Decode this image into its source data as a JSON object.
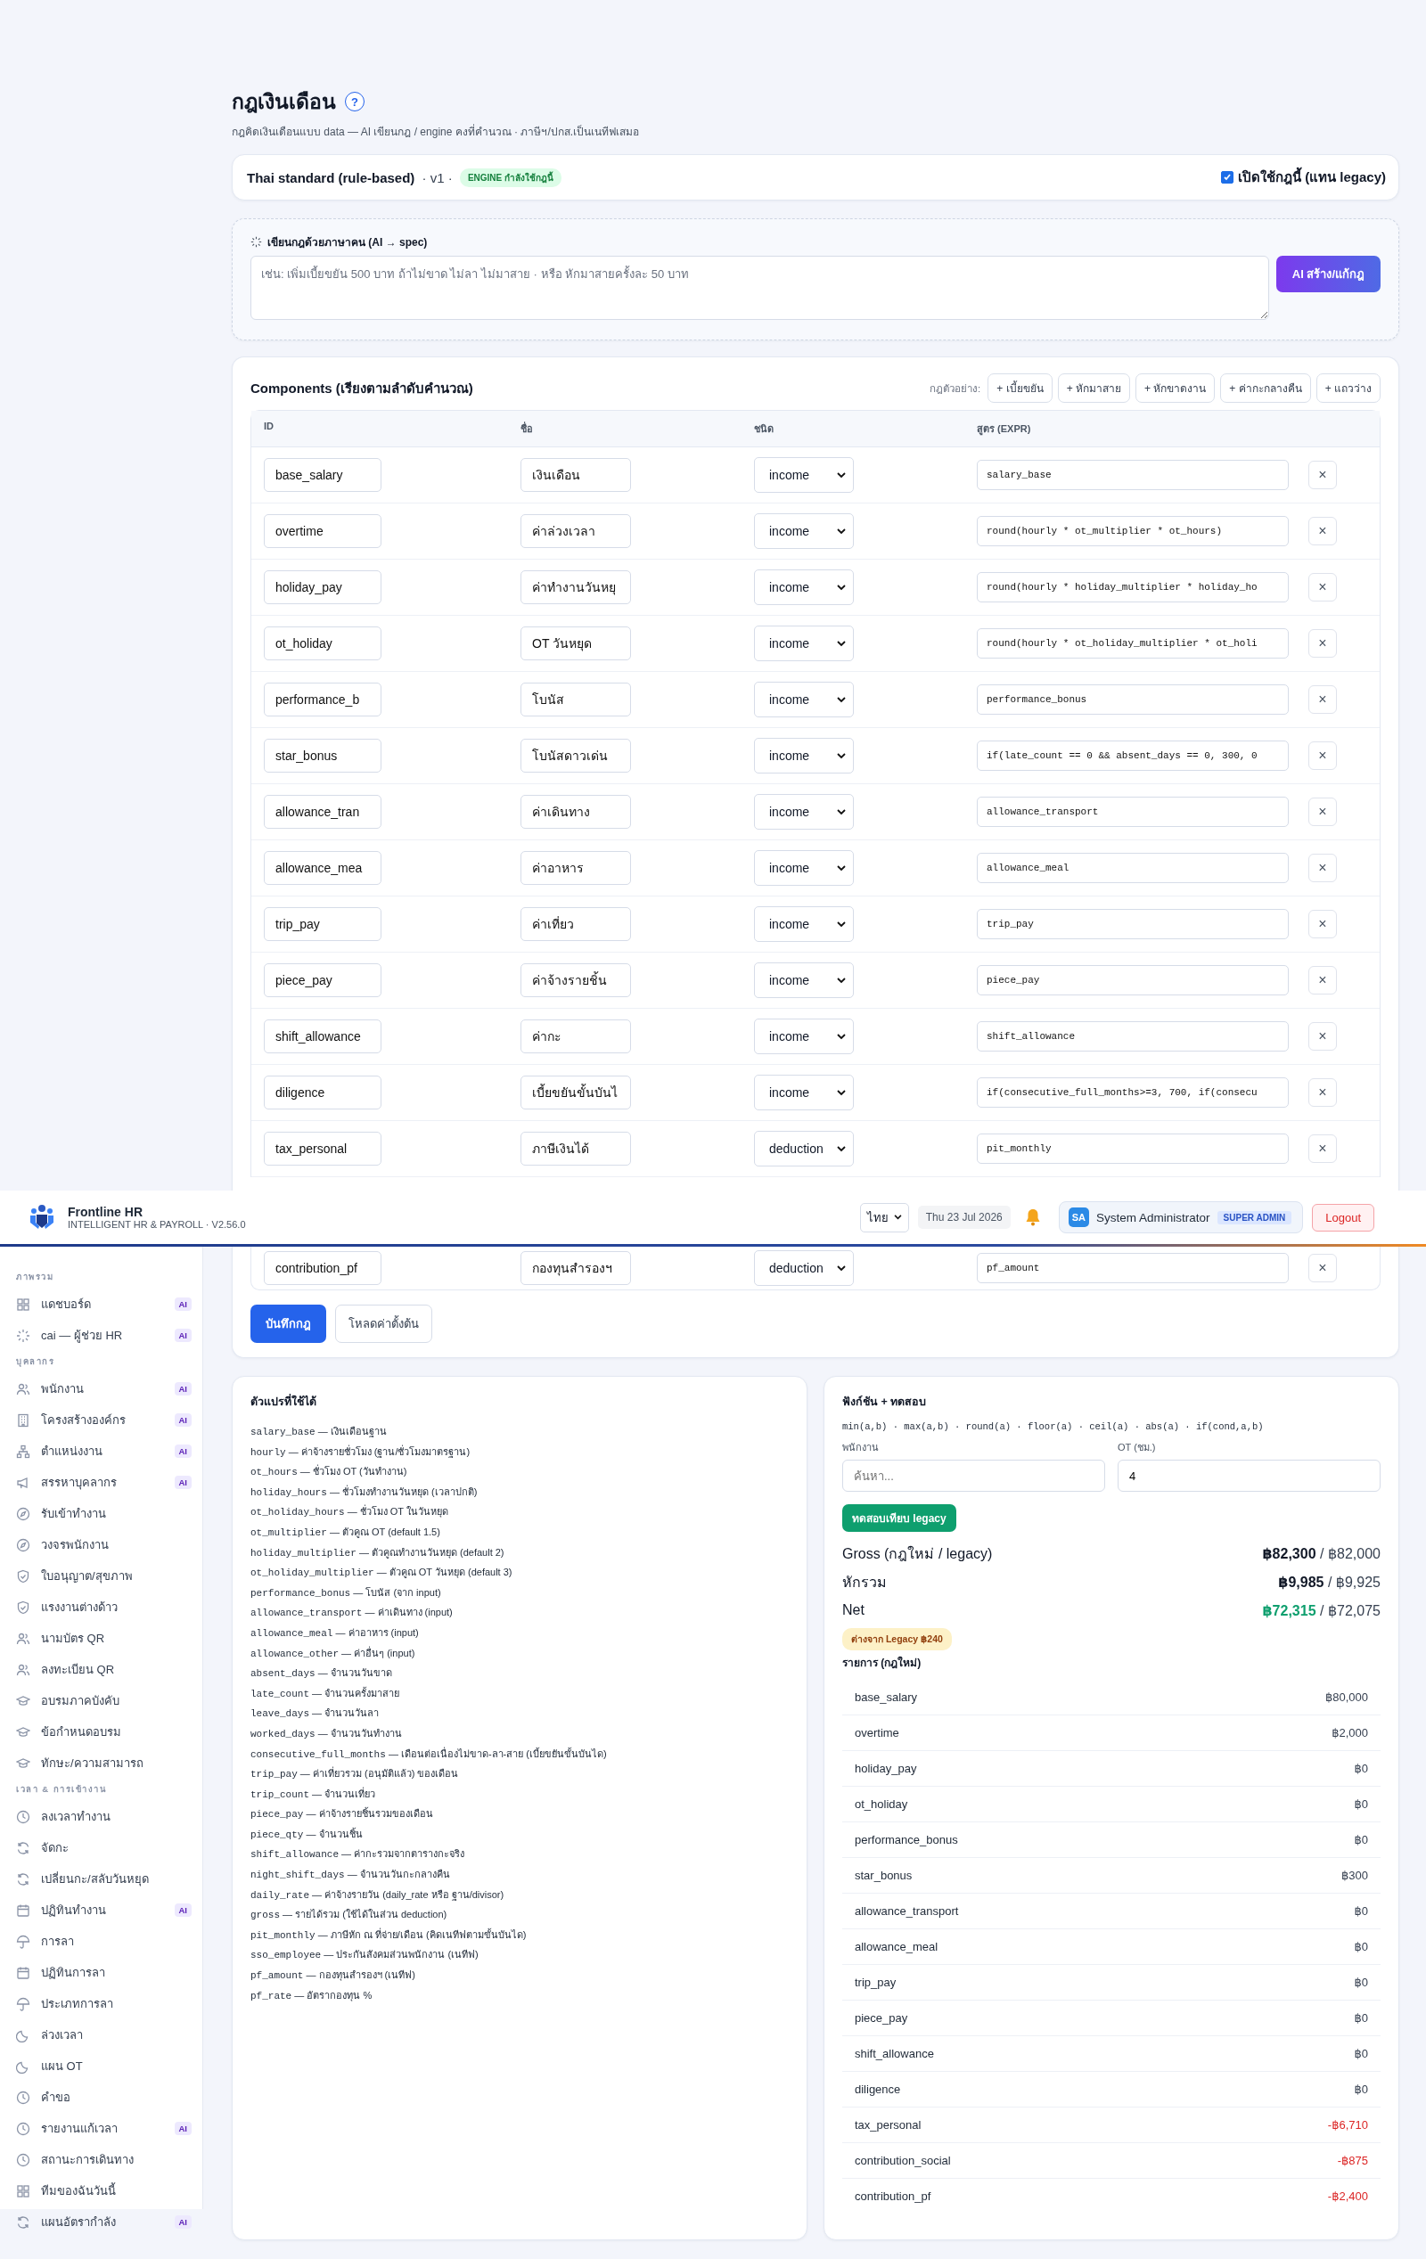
{
  "page": {
    "title": "กฎเงินเดือน",
    "help": "?",
    "subtitle": "กฎคิดเงินเดือนแบบ data — AI เขียนกฎ / engine คงที่คำนวณ · ภาษีฯ/ปกส.เป็นเนทีฟเสมอ"
  },
  "rule": {
    "name": "Thai standard (rule-based)",
    "version": " · v1 · ",
    "badge": "ENGINE กำลังใช้กฎนี้",
    "enabled": true,
    "enabled_label": "เปิดใช้กฎนี้ (แทน legacy)"
  },
  "ai_spec": {
    "title": "เขียนกฎด้วยภาษาคน (AI → spec)",
    "placeholder": "เช่น: เพิ่มเบี้ยขยัน 500 บาท ถ้าไม่ขาด ไม่ลา ไม่มาสาย · หรือ หักมาสายครั้งละ 50 บาท",
    "button": "AI สร้าง/แก้กฎ"
  },
  "components": {
    "title": "Components (เรียงตามลำดับคำนวณ)",
    "examples_label": "กฎตัวอย่าง:",
    "examples": [
      "+ เบี้ยขยัน",
      "+ หักมาสาย",
      "+ หักขาดงาน",
      "+ ค่ากะกลางคืน",
      "+ แถวว่าง"
    ],
    "columns": [
      "ID",
      "ชื่อ",
      "ชนิด",
      "สูตร (EXPR)"
    ],
    "rows": [
      {
        "id": "base_salary",
        "name": "เงินเดือน",
        "type": "income",
        "expr": "salary_base",
        "remove": "×"
      },
      {
        "id": "overtime",
        "name": "ค่าล่วงเวลา",
        "type": "income",
        "expr": "round(hourly * ot_multiplier * ot_hours)",
        "remove": "×"
      },
      {
        "id": "holiday_pay",
        "name": "ค่าทำงานวันหยุ",
        "type": "income",
        "expr": "round(hourly * holiday_multiplier * holiday_ho",
        "remove": "×"
      },
      {
        "id": "ot_holiday",
        "name": "OT วันหยุด",
        "type": "income",
        "expr": "round(hourly * ot_holiday_multiplier * ot_holi",
        "remove": "×"
      },
      {
        "id": "performance_b",
        "name": "โบนัส",
        "type": "income",
        "expr": "performance_bonus",
        "remove": "×"
      },
      {
        "id": "star_bonus",
        "name": "โบนัสดาวเด่น",
        "type": "income",
        "expr": "if(late_count == 0 && absent_days == 0, 300, 0",
        "remove": "×"
      },
      {
        "id": "allowance_tran",
        "name": "ค่าเดินทาง",
        "type": "income",
        "expr": "allowance_transport",
        "remove": "×"
      },
      {
        "id": "allowance_mea",
        "name": "ค่าอาหาร",
        "type": "income",
        "expr": "allowance_meal",
        "remove": "×"
      },
      {
        "id": "trip_pay",
        "name": "ค่าเที่ยว",
        "type": "income",
        "expr": "trip_pay",
        "remove": "×"
      },
      {
        "id": "piece_pay",
        "name": "ค่าจ้างรายชิ้น",
        "type": "income",
        "expr": "piece_pay",
        "remove": "×"
      },
      {
        "id": "shift_allowance",
        "name": "ค่ากะ",
        "type": "income",
        "expr": "shift_allowance",
        "remove": "×"
      },
      {
        "id": "diligence",
        "name": "เบี้ยขยันขั้นบันไ",
        "type": "income",
        "expr": "if(consecutive_full_months>=3, 700, if(consecu",
        "remove": "×"
      },
      {
        "id": "tax_personal",
        "name": "ภาษีเงินได้",
        "type": "deduction",
        "expr": "pit_monthly",
        "remove": "×"
      },
      {
        "id": "contribution_pf",
        "name": "กองทุนสำรองฯ",
        "type": "deduction",
        "expr": "pf_amount",
        "remove": "×"
      }
    ],
    "save": "บันทึกกฎ",
    "reset": "โหลดค่าตั้งต้น"
  },
  "header": {
    "brand": "Frontline HR",
    "tagline": "INTELLIGENT HR & PAYROLL · V2.56.0",
    "language": "ไทย",
    "date": "Thu 23 Jul 2026",
    "avatar": "SA",
    "user": "System Administrator",
    "role": "SUPER ADMIN",
    "logout": "Logout"
  },
  "sidebar": [
    {
      "title": "ภาพรวม",
      "items": [
        {
          "label": "แดชบอร์ด",
          "badge": "AI"
        },
        {
          "label": "cai — ผู้ช่วย HR",
          "badge": "AI"
        }
      ]
    },
    {
      "title": "บุคลากร",
      "items": [
        {
          "label": "พนักงาน",
          "badge": "AI"
        },
        {
          "label": "โครงสร้างองค์กร",
          "badge": "AI"
        },
        {
          "label": "ตำแหน่งงาน",
          "badge": "AI"
        },
        {
          "label": "สรรหาบุคลากร",
          "badge": "AI"
        },
        {
          "label": "รับเข้าทำงาน"
        },
        {
          "label": "วงจรพนักงาน"
        },
        {
          "label": "ใบอนุญาต/สุขภาพ"
        },
        {
          "label": "แรงงานต่างด้าว"
        },
        {
          "label": "นามบัตร QR"
        },
        {
          "label": "ลงทะเบียน QR"
        },
        {
          "label": "อบรมภาคบังคับ"
        },
        {
          "label": "ข้อกำหนดอบรม"
        },
        {
          "label": "ทักษะ/ความสามารถ"
        }
      ]
    },
    {
      "title": "เวลา & การเข้างาน",
      "items": [
        {
          "label": "ลงเวลาทำงาน"
        },
        {
          "label": "จัดกะ"
        },
        {
          "label": "เปลี่ยนกะ/สลับวันหยุด"
        },
        {
          "label": "ปฏิทินทำงาน",
          "badge": "AI"
        },
        {
          "label": "การลา"
        },
        {
          "label": "ปฏิทินการลา"
        },
        {
          "label": "ประเภทการลา"
        },
        {
          "label": "ล่วงเวลา"
        },
        {
          "label": "แผน OT"
        },
        {
          "label": "คำขอ"
        },
        {
          "label": "รายงานแก้เวลา",
          "badge": "AI"
        },
        {
          "label": "สถานะการเดินทาง"
        },
        {
          "label": "ทีมของฉันวันนี้"
        },
        {
          "label": "แผนอัตรากำลัง",
          "badge": "AI"
        }
      ]
    }
  ],
  "variables": {
    "title": "ตัวแปรที่ใช้ได้",
    "items": [
      {
        "name": "salary_base",
        "desc": "— เงินเดือนฐาน"
      },
      {
        "name": "hourly",
        "desc": "— ค่าจ้างรายชั่วโมง (ฐาน/ชั่วโมงมาตรฐาน)"
      },
      {
        "name": "ot_hours",
        "desc": "— ชั่วโมง OT (วันทำงาน)"
      },
      {
        "name": "holiday_hours",
        "desc": "— ชั่วโมงทำงานวันหยุด (เวลาปกติ)"
      },
      {
        "name": "ot_holiday_hours",
        "desc": "— ชั่วโมง OT ในวันหยุด"
      },
      {
        "name": "ot_multiplier",
        "desc": "— ตัวคูณ OT (default 1.5)"
      },
      {
        "name": "holiday_multiplier",
        "desc": "— ตัวคูณทำงานวันหยุด (default 2)"
      },
      {
        "name": "ot_holiday_multiplier",
        "desc": "— ตัวคูณ OT วันหยุด (default 3)"
      },
      {
        "name": "performance_bonus",
        "desc": "— โบนัส (จาก input)"
      },
      {
        "name": "allowance_transport",
        "desc": "— ค่าเดินทาง (input)"
      },
      {
        "name": "allowance_meal",
        "desc": "— ค่าอาหาร (input)"
      },
      {
        "name": "allowance_other",
        "desc": "— ค่าอื่นๆ (input)"
      },
      {
        "name": "absent_days",
        "desc": "— จำนวนวันขาด"
      },
      {
        "name": "late_count",
        "desc": "— จำนวนครั้งมาสาย"
      },
      {
        "name": "leave_days",
        "desc": "— จำนวนวันลา"
      },
      {
        "name": "worked_days",
        "desc": "— จำนวนวันทำงาน"
      },
      {
        "name": "consecutive_full_months",
        "desc": "— เดือนต่อเนื่องไม่ขาด-ลา-สาย (เบี้ยขยันขั้นบันได)"
      },
      {
        "name": "trip_pay",
        "desc": "— ค่าเที่ยวรวม (อนุมัติแล้ว) ของเดือน"
      },
      {
        "name": "trip_count",
        "desc": "— จำนวนเที่ยว"
      },
      {
        "name": "piece_pay",
        "desc": "— ค่าจ้างรายชิ้นรวมของเดือน"
      },
      {
        "name": "piece_qty",
        "desc": "— จำนวนชิ้น"
      },
      {
        "name": "shift_allowance",
        "desc": "— ค่ากะรวมจากตารางกะจริง"
      },
      {
        "name": "night_shift_days",
        "desc": "— จำนวนวันกะกลางคืน"
      },
      {
        "name": "daily_rate",
        "desc": "— ค่าจ้างรายวัน (daily_rate หรือ ฐาน/divisor)"
      },
      {
        "name": "gross",
        "desc": "— รายได้รวม (ใช้ได้ในส่วน deduction)"
      },
      {
        "name": "pit_monthly",
        "desc": "— ภาษีหัก ณ ที่จ่าย/เดือน (คิดเนทีฟตามขั้นบันได)"
      },
      {
        "name": "sso_employee",
        "desc": "— ประกันสังคมส่วนพนักงาน (เนทีฟ)"
      },
      {
        "name": "pf_amount",
        "desc": "— กองทุนสำรองฯ (เนทีฟ)"
      },
      {
        "name": "pf_rate",
        "desc": "— อัตรากองทุน %"
      }
    ]
  },
  "test": {
    "title": "ฟังก์ชัน + ทดสอบ",
    "functions": "min(a,b) · max(a,b) · round(a) · floor(a) · ceil(a) · abs(a) · if(cond,a,b)",
    "employee_label": "พนักงาน",
    "employee_placeholder": "ค้นหา...",
    "ot_label": "OT (ชม.)",
    "ot_value": "4",
    "button": "ทดสอบเทียบ legacy",
    "summary": [
      {
        "label": "Gross (กฎใหม่ / legacy)",
        "new": "฿82,300",
        "legacy": "/ ฿82,000",
        "kind": "plain"
      },
      {
        "label": "หักรวม",
        "new": "฿9,985",
        "legacy": "/ ฿9,925",
        "kind": "plain"
      },
      {
        "label": "Net",
        "new": "฿72,315",
        "legacy": "/ ฿72,075",
        "kind": "net"
      }
    ],
    "diff": "ต่างจาก Legacy ฿240",
    "items_title": "รายการ (กฎใหม่)",
    "items": [
      {
        "name": "base_salary",
        "amount": "฿80,000",
        "kind": "income"
      },
      {
        "name": "overtime",
        "amount": "฿2,000",
        "kind": "income"
      },
      {
        "name": "holiday_pay",
        "amount": "฿0",
        "kind": "income"
      },
      {
        "name": "ot_holiday",
        "amount": "฿0",
        "kind": "income"
      },
      {
        "name": "performance_bonus",
        "amount": "฿0",
        "kind": "income"
      },
      {
        "name": "star_bonus",
        "amount": "฿300",
        "kind": "income"
      },
      {
        "name": "allowance_transport",
        "amount": "฿0",
        "kind": "income"
      },
      {
        "name": "allowance_meal",
        "amount": "฿0",
        "kind": "income"
      },
      {
        "name": "trip_pay",
        "amount": "฿0",
        "kind": "income"
      },
      {
        "name": "piece_pay",
        "amount": "฿0",
        "kind": "income"
      },
      {
        "name": "shift_allowance",
        "amount": "฿0",
        "kind": "income"
      },
      {
        "name": "diligence",
        "amount": "฿0",
        "kind": "income"
      },
      {
        "name": "tax_personal",
        "amount": "-฿6,710",
        "kind": "deduction"
      },
      {
        "name": "contribution_social",
        "amount": "-฿875",
        "kind": "deduction"
      },
      {
        "name": "contribution_pf",
        "amount": "-฿2,400",
        "kind": "deduction"
      }
    ]
  }
}
